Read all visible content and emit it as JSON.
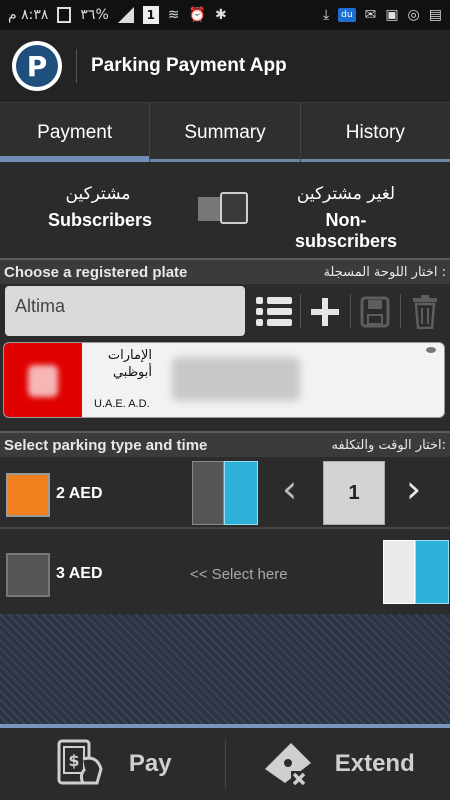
{
  "status_bar": {
    "time": "٨:٣٨ م",
    "battery": "٣٦%",
    "sim_label": "1",
    "carrier_chip": "du"
  },
  "app_bar": {
    "logo_letter": "P",
    "title": "Parking Payment App"
  },
  "tabs": [
    {
      "label": "Payment",
      "active": true
    },
    {
      "label": "Summary",
      "active": false
    },
    {
      "label": "History",
      "active": false
    }
  ],
  "subscription": {
    "subscribers_ar": "مشتركين",
    "subscribers_en": "Subscribers",
    "non_subscribers_ar": "لغير مشتركين",
    "non_subscribers_en": "Non-subscribers",
    "toggle_state": "non-subscribers"
  },
  "plate_section": {
    "header_en": "Choose a registered plate",
    "header_ar": "اختار اللوحة المسجلة :",
    "selected_plate": "Altima",
    "plate": {
      "emirate_ar_line1": "الإمارات",
      "emirate_ar_line2": "أبوظبي",
      "emirate_en": "U.A.E. A.D."
    }
  },
  "parking_section": {
    "header_en": "Select parking type and time",
    "header_ar": "اختار الوقت والتكلفه:",
    "options": [
      {
        "price": "2 AED",
        "selected": true,
        "color": "#f07f1e",
        "quantity": "1"
      },
      {
        "price": "3 AED",
        "selected": false,
        "color": "#555555",
        "hint": "<< Select here"
      }
    ]
  },
  "bottom_bar": {
    "pay_label": "Pay",
    "extend_label": "Extend"
  },
  "colors": {
    "accent": "#6f8fb8",
    "time_segment": "#2db1d8",
    "plate_red": "#e00000"
  }
}
